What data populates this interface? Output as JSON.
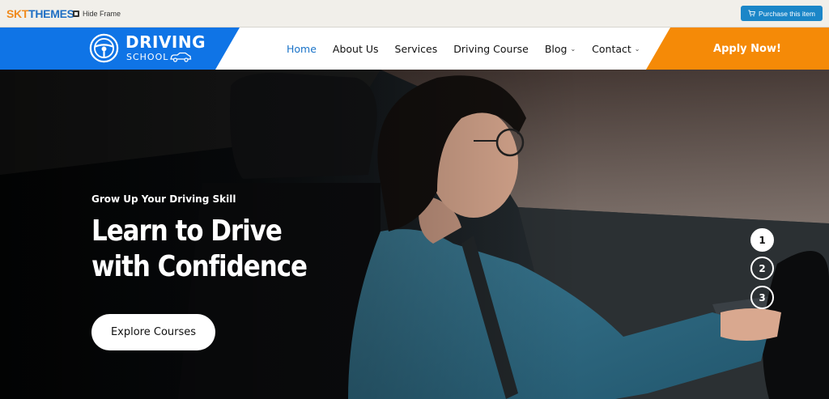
{
  "topbar": {
    "brand_part1": "SKT",
    "brand_part2": "THEMES",
    "hide_frame_label": "Hide Frame",
    "purchase_label": "Purchase this item"
  },
  "header": {
    "logo_title": "DRIVING",
    "logo_subtitle": "SCHOOL",
    "nav": [
      {
        "label": "Home",
        "active": true
      },
      {
        "label": "About Us"
      },
      {
        "label": "Services"
      },
      {
        "label": "Driving Course"
      },
      {
        "label": "Blog",
        "dropdown": true
      },
      {
        "label": "Contact",
        "dropdown": true
      }
    ],
    "apply_label": "Apply Now!"
  },
  "hero": {
    "kicker": "Grow Up Your Driving Skill",
    "title": "Learn to Drive with Confidence",
    "button_label": "Explore Courses",
    "slides": [
      "1",
      "2",
      "3"
    ],
    "active_slide": 1
  },
  "colors": {
    "brand_blue": "#0f74e6",
    "accent_orange": "#f58a07",
    "purchase_blue": "#1b86c8",
    "active_nav": "#1a73c8"
  }
}
